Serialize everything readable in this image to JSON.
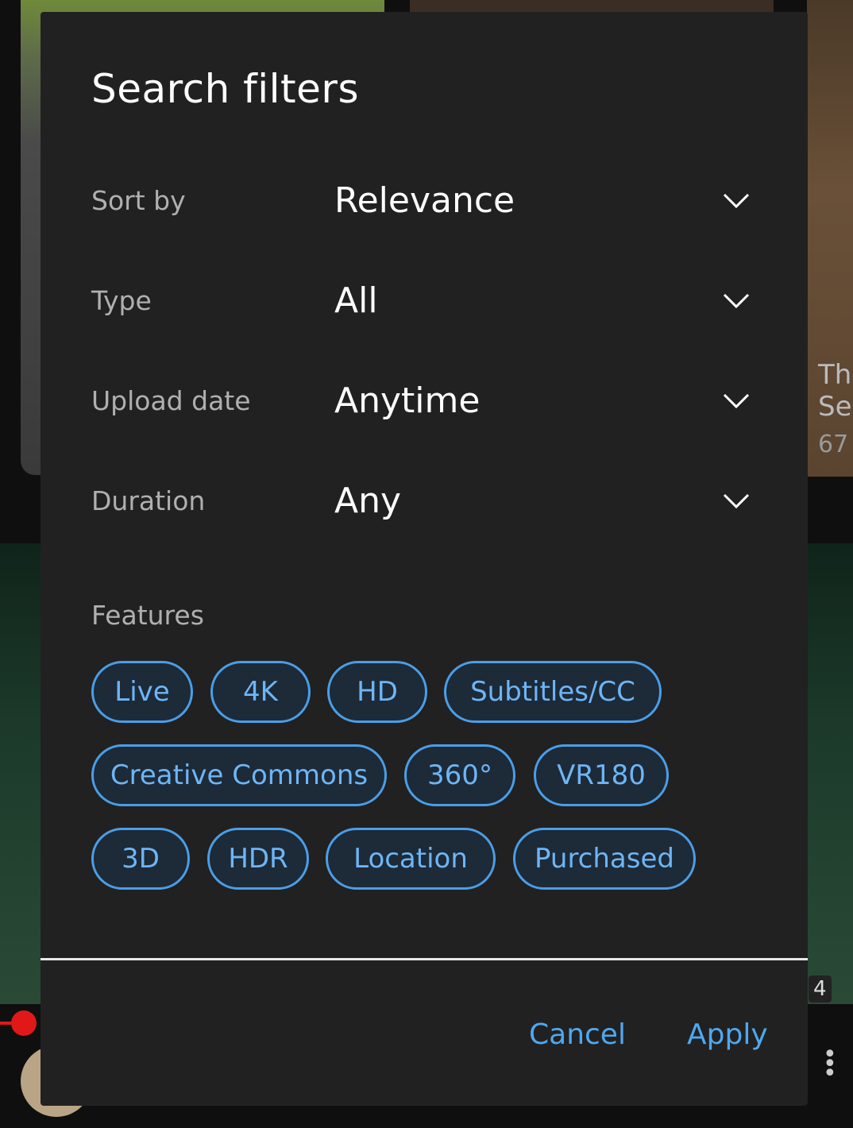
{
  "dialog": {
    "title": "Search filters",
    "rows": [
      {
        "label": "Sort by",
        "value": "Relevance"
      },
      {
        "label": "Type",
        "value": "All"
      },
      {
        "label": "Upload date",
        "value": "Anytime"
      },
      {
        "label": "Duration",
        "value": "Any"
      }
    ],
    "features_label": "Features",
    "chips": [
      "Live",
      "4K",
      "HD",
      "Subtitles/CC",
      "Creative Commons",
      "360°",
      "VR180",
      "3D",
      "HDR",
      "Location",
      "Purchased"
    ],
    "cancel_label": "Cancel",
    "apply_label": "Apply"
  },
  "background": {
    "side_text_1": "The",
    "side_text_2": "Se",
    "side_text_3": "67",
    "badge": "4"
  },
  "colors": {
    "dialog_bg": "#212121",
    "chip_border": "#4a9ee8",
    "chip_text": "#6eb5f5",
    "button_text": "#4ea8f0"
  },
  "icons": {
    "dropdown": "chevron-down-icon",
    "more": "more-vert-icon"
  }
}
